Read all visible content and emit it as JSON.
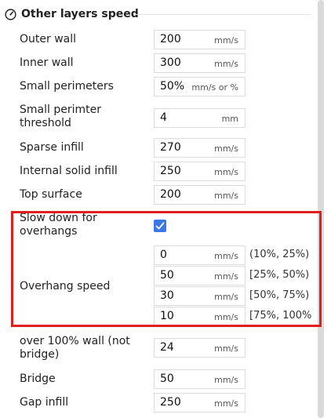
{
  "section": {
    "title": "Other layers speed",
    "icon": "gauge-icon"
  },
  "rows": {
    "outer_wall": {
      "label": "Outer wall",
      "value": "200",
      "unit": "mm/s"
    },
    "inner_wall": {
      "label": "Inner wall",
      "value": "300",
      "unit": "mm/s"
    },
    "small_perimeters": {
      "label": "Small perimeters",
      "value": "50%",
      "unit": "mm/s or %"
    },
    "small_perimeter_threshold": {
      "label_line1": "Small perimter",
      "label_line2": "threshold",
      "value": "4",
      "unit": "mm"
    },
    "sparse_infill": {
      "label": "Sparse infill",
      "value": "270",
      "unit": "mm/s"
    },
    "internal_solid_infill": {
      "label": "Internal solid infill",
      "value": "250",
      "unit": "mm/s"
    },
    "top_surface": {
      "label": "Top surface",
      "value": "200",
      "unit": "mm/s"
    }
  },
  "slow_down": {
    "label_line1": "Slow down for",
    "label_line2": "overhangs",
    "checked": true
  },
  "overhang_speed": {
    "label": "Overhang speed",
    "entries": [
      {
        "value": "0",
        "unit": "mm/s",
        "range": "(10%, 25%)"
      },
      {
        "value": "50",
        "unit": "mm/s",
        "range": "[25%, 50%)"
      },
      {
        "value": "30",
        "unit": "mm/s",
        "range": "[50%, 75%)"
      },
      {
        "value": "10",
        "unit": "mm/s",
        "range": "[75%, 100%"
      }
    ]
  },
  "rows2": {
    "over_100_wall": {
      "label_line1": "over 100% wall (not",
      "label_line2": "bridge)",
      "value": "24",
      "unit": "mm/s"
    },
    "bridge": {
      "label": "Bridge",
      "value": "50",
      "unit": "mm/s"
    },
    "gap_infill": {
      "label": "Gap infill",
      "value": "250",
      "unit": "mm/s"
    }
  },
  "colors": {
    "accent": "#3a78e6",
    "highlight": "#e02020"
  }
}
